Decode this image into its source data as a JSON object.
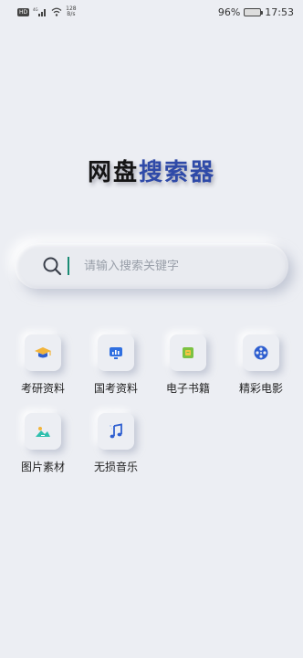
{
  "status_bar": {
    "left_chip": "HD",
    "network_rate": "128",
    "network_unit": "B/s",
    "battery_percent": "96%",
    "time": "17:53"
  },
  "header": {
    "title_part1": "网盘",
    "title_part2": "搜索器"
  },
  "search": {
    "placeholder": "请输入搜索关键字",
    "value": ""
  },
  "categories": [
    {
      "label": "考研资料",
      "icon": "graduation-cap-icon"
    },
    {
      "label": "国考资料",
      "icon": "monitor-chart-icon"
    },
    {
      "label": "电子书籍",
      "icon": "ebook-icon"
    },
    {
      "label": "精彩电影",
      "icon": "film-reel-icon"
    },
    {
      "label": "图片素材",
      "icon": "picture-icon"
    },
    {
      "label": "无损音乐",
      "icon": "music-note-icon"
    }
  ],
  "colors": {
    "background": "#eceef3",
    "title_accent": "#2f4aa8",
    "cursor": "#1a8b74"
  }
}
